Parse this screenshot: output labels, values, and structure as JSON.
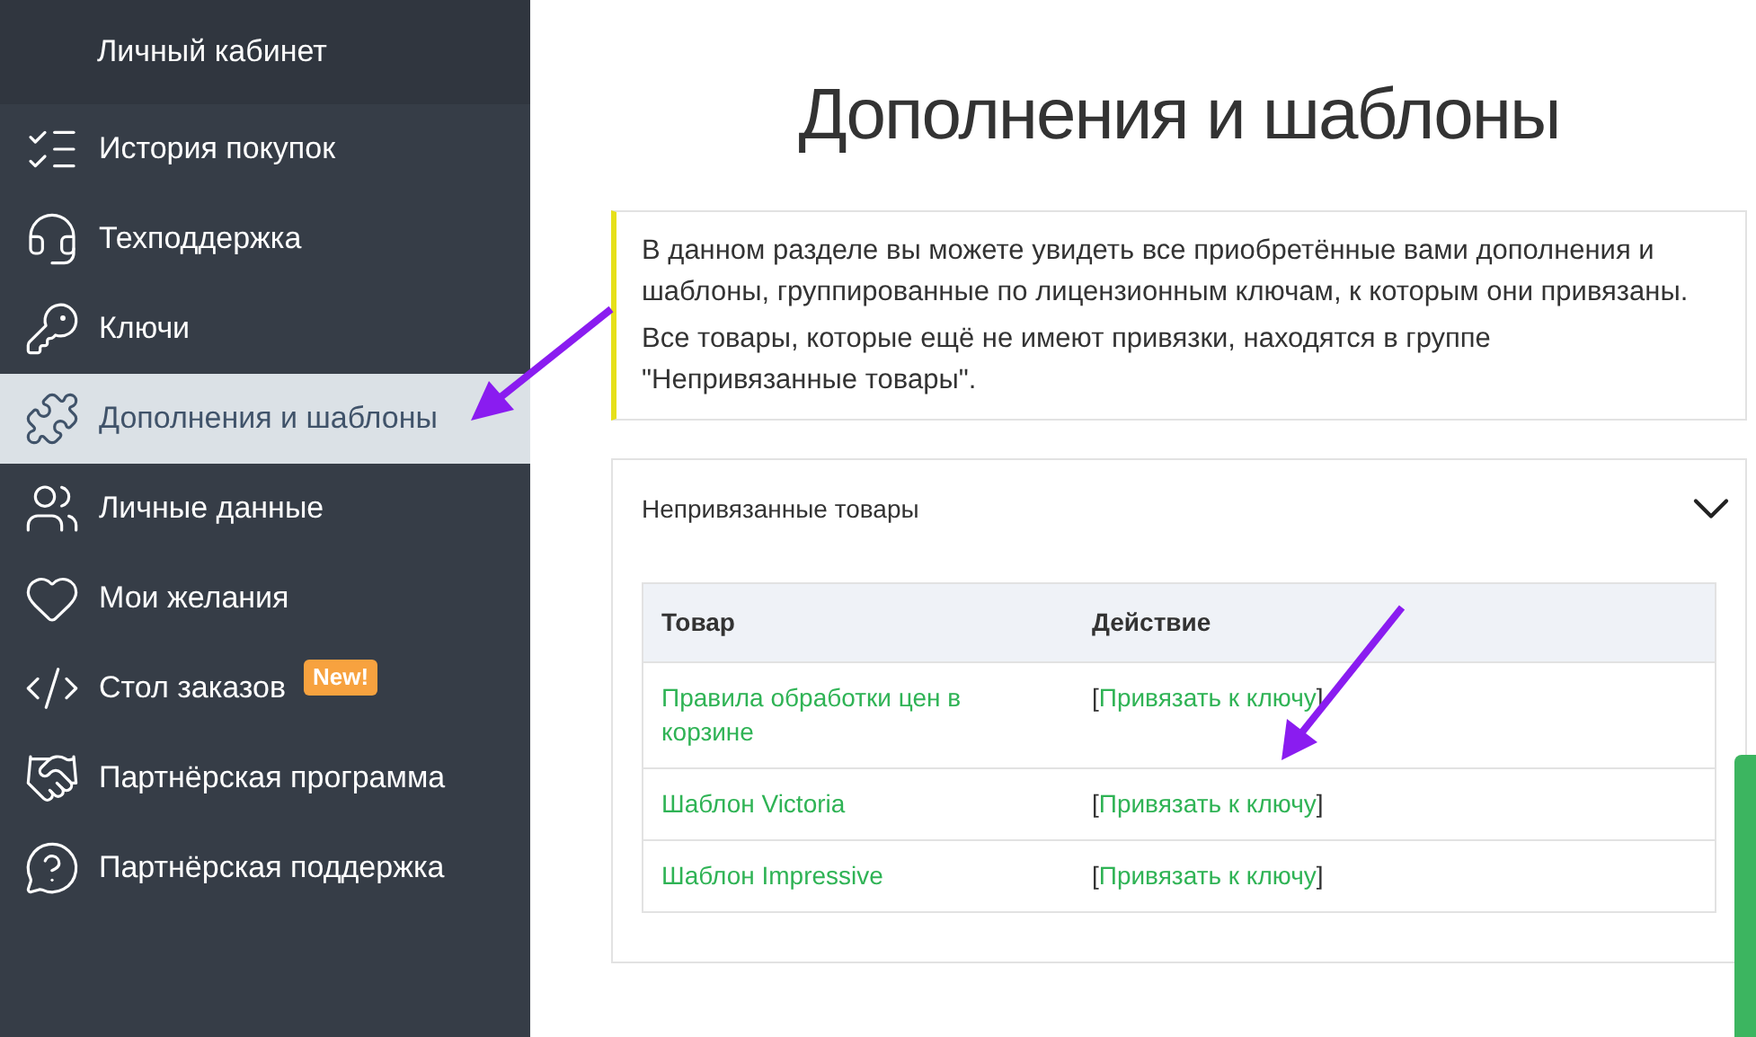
{
  "sidebar": {
    "title": "Личный кабинет",
    "items": [
      {
        "label": "История покупок",
        "selected": false
      },
      {
        "label": "Техподдержка",
        "selected": false
      },
      {
        "label": "Ключи",
        "selected": false
      },
      {
        "label": "Дополнения и шаблоны",
        "selected": true
      },
      {
        "label": "Личные данные",
        "selected": false
      },
      {
        "label": "Мои желания",
        "selected": false
      },
      {
        "label": "Стол заказов",
        "selected": false,
        "badge": "New!"
      },
      {
        "label": "Партнёрская программа",
        "selected": false
      },
      {
        "label": "Партнёрская поддержка",
        "selected": false
      }
    ]
  },
  "page": {
    "title": "Дополнения и шаблоны",
    "info": [
      "В данном разделе вы можете увидеть все приобретённые вами дополнения и шаблоны, группированные по лицензионным ключам, к которым они привязаны.",
      "Все товары, которые ещё не имеют привязки, находятся в группе \"Непривязанные товары\"."
    ],
    "group": {
      "title": "Непривязанные товары",
      "expanded": true,
      "table": {
        "columns": [
          "Товар",
          "Действие"
        ],
        "rows": [
          {
            "product": "Правила обработки цен в корзине",
            "action_open": "[",
            "action": "Привязать к ключу",
            "action_close": "]"
          },
          {
            "product": "Шаблон Victoria",
            "action_open": "[",
            "action": "Привязать к ключу",
            "action_close": "]"
          },
          {
            "product": "Шаблон Impressive",
            "action_open": "[",
            "action": "Привязать к ключу",
            "action_close": "]"
          }
        ]
      }
    }
  }
}
